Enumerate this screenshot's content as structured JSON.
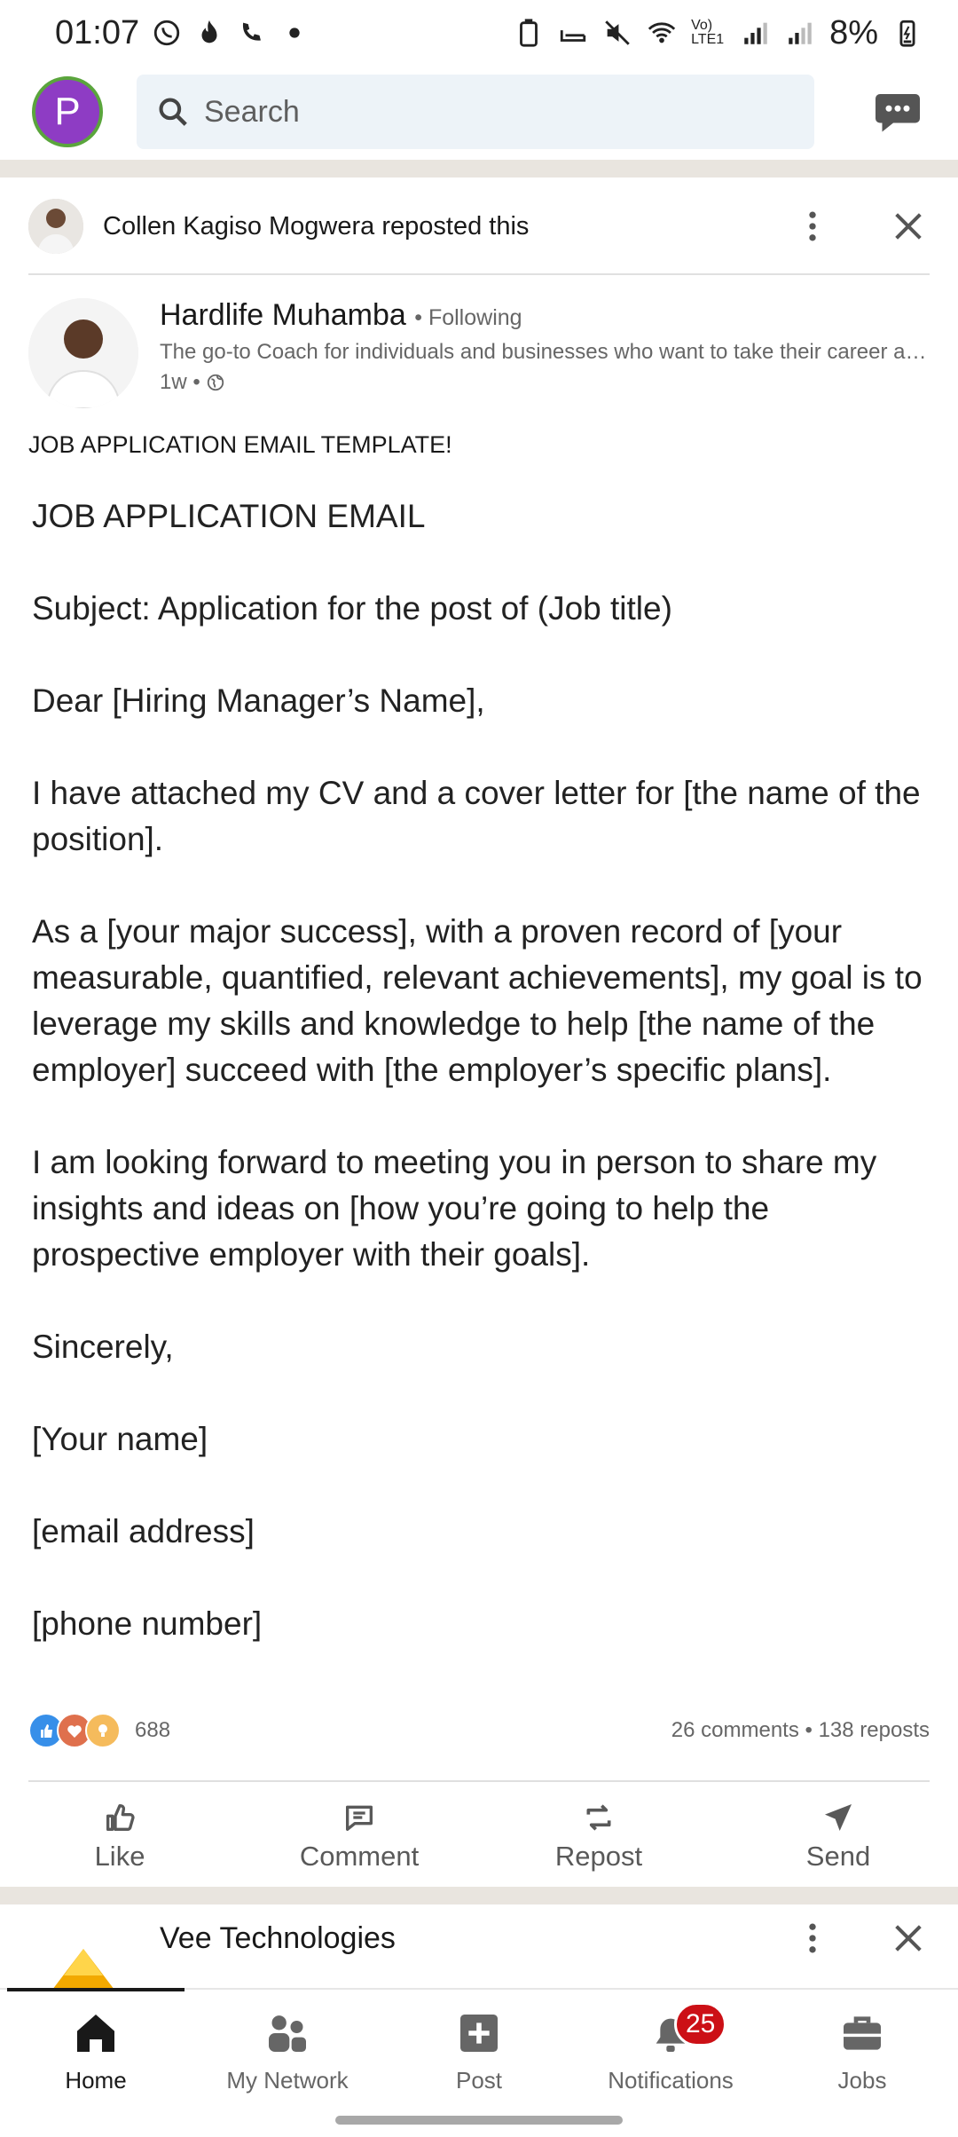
{
  "status_bar": {
    "time": "01:07",
    "network": "Vo) LTE1",
    "battery": "8%"
  },
  "top_bar": {
    "avatar_initial": "P",
    "search_placeholder": "Search"
  },
  "repost": {
    "reposter_name": "Collen Kagiso Mogwera",
    "repost_suffix": "reposted this"
  },
  "author": {
    "name": "Hardlife Muhamba",
    "follow_status": "• Following",
    "headline": "The go-to Coach for individuals and businesses who want to take their career and business to the next level",
    "time": "1w •"
  },
  "post": {
    "caption": "JOB APPLICATION EMAIL TEMPLATE!",
    "paragraphs": [
      "JOB APPLICATION EMAIL",
      "Subject: Application for the post of (Job title)",
      "Dear [Hiring Manager’s Name],",
      "I have attached my CV and a cover letter for [the name of the position].",
      "As a [your major success], with a proven record of [your measurable, quantified, relevant achievements], my goal is to leverage my skills and knowledge to help [the name of the employer] succeed with [the employer’s specific plans].",
      "I am looking forward to meeting you in person to share my insights and ideas on [how you’re going to help the prospective employer with their goals].",
      "Sincerely,",
      "[Your name]",
      "[email address]",
      "[phone number]"
    ]
  },
  "reactions": {
    "count": "688",
    "stats": "26 comments • 138 reposts"
  },
  "actions": {
    "like": "Like",
    "comment": "Comment",
    "repost": "Repost",
    "send": "Send"
  },
  "next_post": {
    "company_name": "Vee Technologies"
  },
  "bottom_nav": {
    "home": "Home",
    "my_network": "My Network",
    "post": "Post",
    "notifications": "Notifications",
    "notifications_badge": "25",
    "jobs": "Jobs"
  },
  "colors": {
    "linkedin_blue": "#0a66c2",
    "badge_red": "#cc1016",
    "avatar_purple": "#8e3cc4",
    "search_bg": "#edf3f8"
  }
}
